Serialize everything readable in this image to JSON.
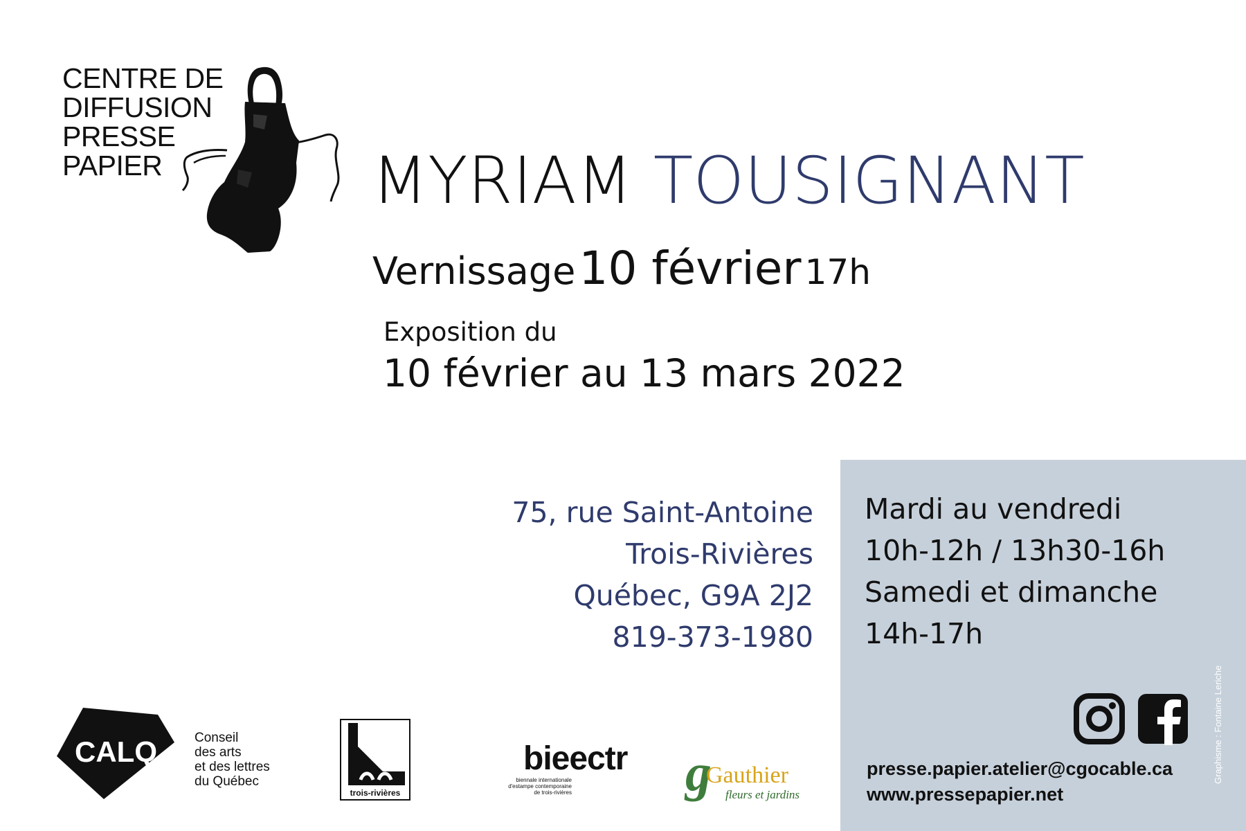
{
  "logo": {
    "lines": [
      "CENTRE DE",
      "DIFFUSION",
      "PRESSE",
      "PAPIER"
    ],
    "icon": "apron-icon"
  },
  "artist": {
    "first": "MYRIAM",
    "last": "TOUSIGNANT"
  },
  "vernissage": {
    "word": "Vernissage",
    "date": "10 février",
    "time": "17h"
  },
  "exposition": {
    "label": "Exposition du",
    "dates": "10 février au 13 mars 2022"
  },
  "address": {
    "street": "75, rue Saint-Antoine",
    "city": "Trois-Rivières",
    "province": "Québec, G9A 2J2",
    "phone": "819-373-1980"
  },
  "hours": {
    "weekdays_label": "Mardi au vendredi",
    "weekdays_hours": "10h-12h / 13h30-16h",
    "weekend_label": "Samedi et dimanche",
    "weekend_hours": "14h-17h"
  },
  "social": {
    "icons": [
      "instagram-icon",
      "facebook-icon"
    ]
  },
  "contact": {
    "email": "presse.papier.atelier@cgocable.ca",
    "website": "www.pressepapier.net"
  },
  "credit": "Graphisme : Fontaine Leriche",
  "sponsors": {
    "calq": {
      "mark": "CALQ",
      "lines": [
        "Conseil",
        "des arts",
        "et des lettres",
        "du Québec"
      ]
    },
    "trois_rivieres": {
      "label": "trois-rivières"
    },
    "biennale": {
      "word": "bieectr",
      "lines": [
        "biennale internationale",
        "d'estampe contemporaine",
        "de trois-rivières"
      ]
    },
    "gauthier": {
      "mark": "g",
      "name": "Gauthier",
      "tagline": "fleurs et jardins"
    }
  },
  "colors": {
    "accent": "#2f3b6c",
    "panel": "#c6d0da",
    "gauthier_green": "#3f7d3c",
    "gauthier_gold": "#d8a41a"
  }
}
